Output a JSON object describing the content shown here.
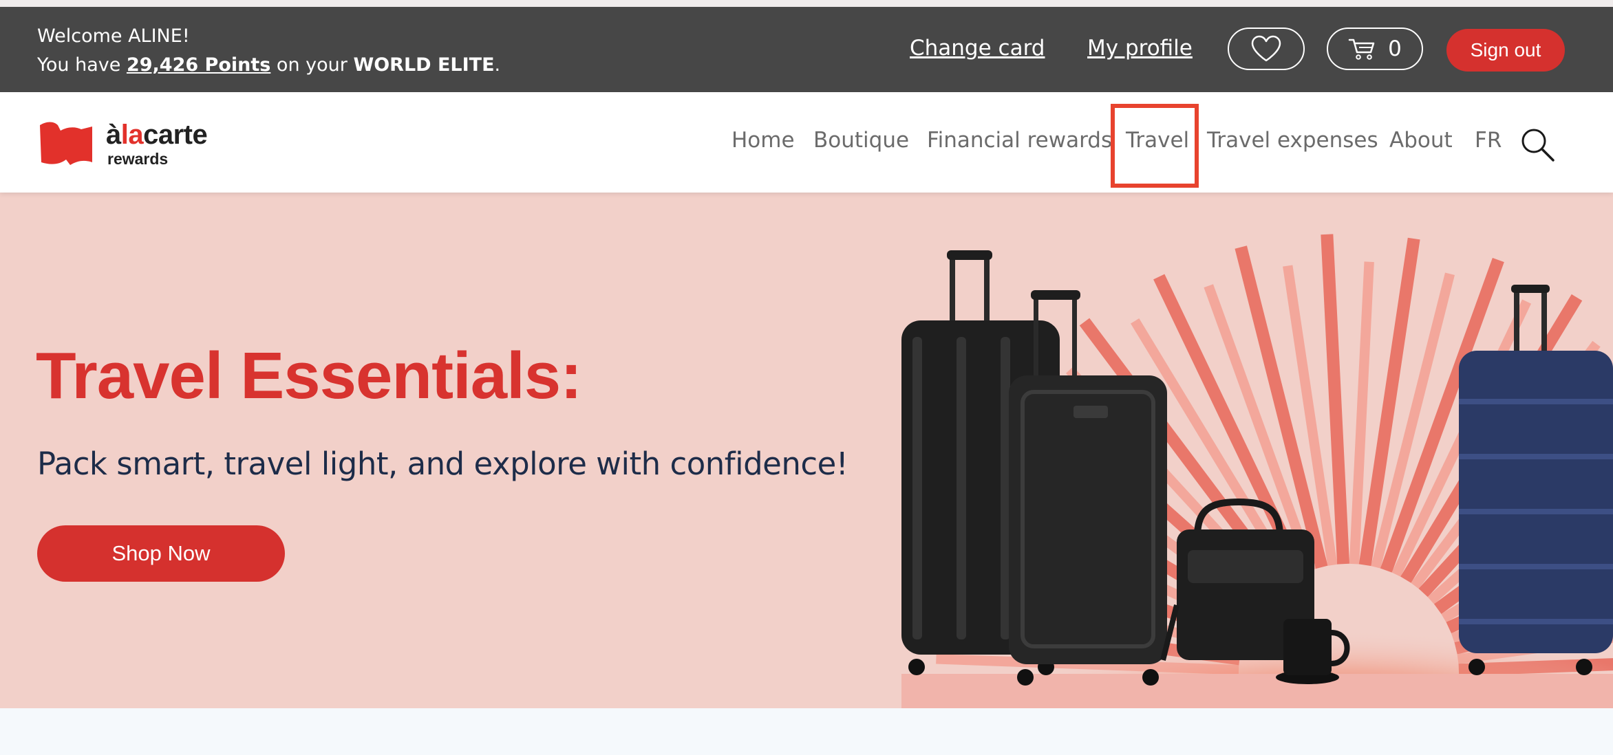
{
  "topbar": {
    "welcome": "Welcome ALINE!",
    "points_prefix": "You have ",
    "points": "29,426 Points",
    "points_mid": " on your ",
    "card_tier": "WORLD ELITE",
    "points_suffix": ".",
    "change_card": "Change card",
    "my_profile": "My profile",
    "wishlist_icon": "heart-icon",
    "cart_icon": "cart-icon",
    "cart_count": "0",
    "sign_out": "Sign out"
  },
  "brand": {
    "logo_alt": "àlacarte rewards",
    "logo_part1": "à",
    "logo_accent": "la",
    "logo_part2": "carte",
    "logo_sub": "rewards",
    "logo_color": "#e2312b"
  },
  "nav": {
    "items": [
      {
        "label": "Home"
      },
      {
        "label": "Boutique"
      },
      {
        "label": "Financial rewards"
      },
      {
        "label": "Travel",
        "highlighted": true
      },
      {
        "label": "Travel expenses"
      },
      {
        "label": "About"
      },
      {
        "label": "FR"
      }
    ],
    "search_icon": "search-icon",
    "highlight_color": "#e8432e"
  },
  "hero": {
    "title": "Travel Essentials:",
    "subtitle": "Pack smart, travel light, and explore with confidence!",
    "cta": "Shop Now",
    "background": "#f2d0c9",
    "accent": "#d5312e",
    "image_alt": "Luggage, laptop bag and mug in front of a red sunburst"
  }
}
